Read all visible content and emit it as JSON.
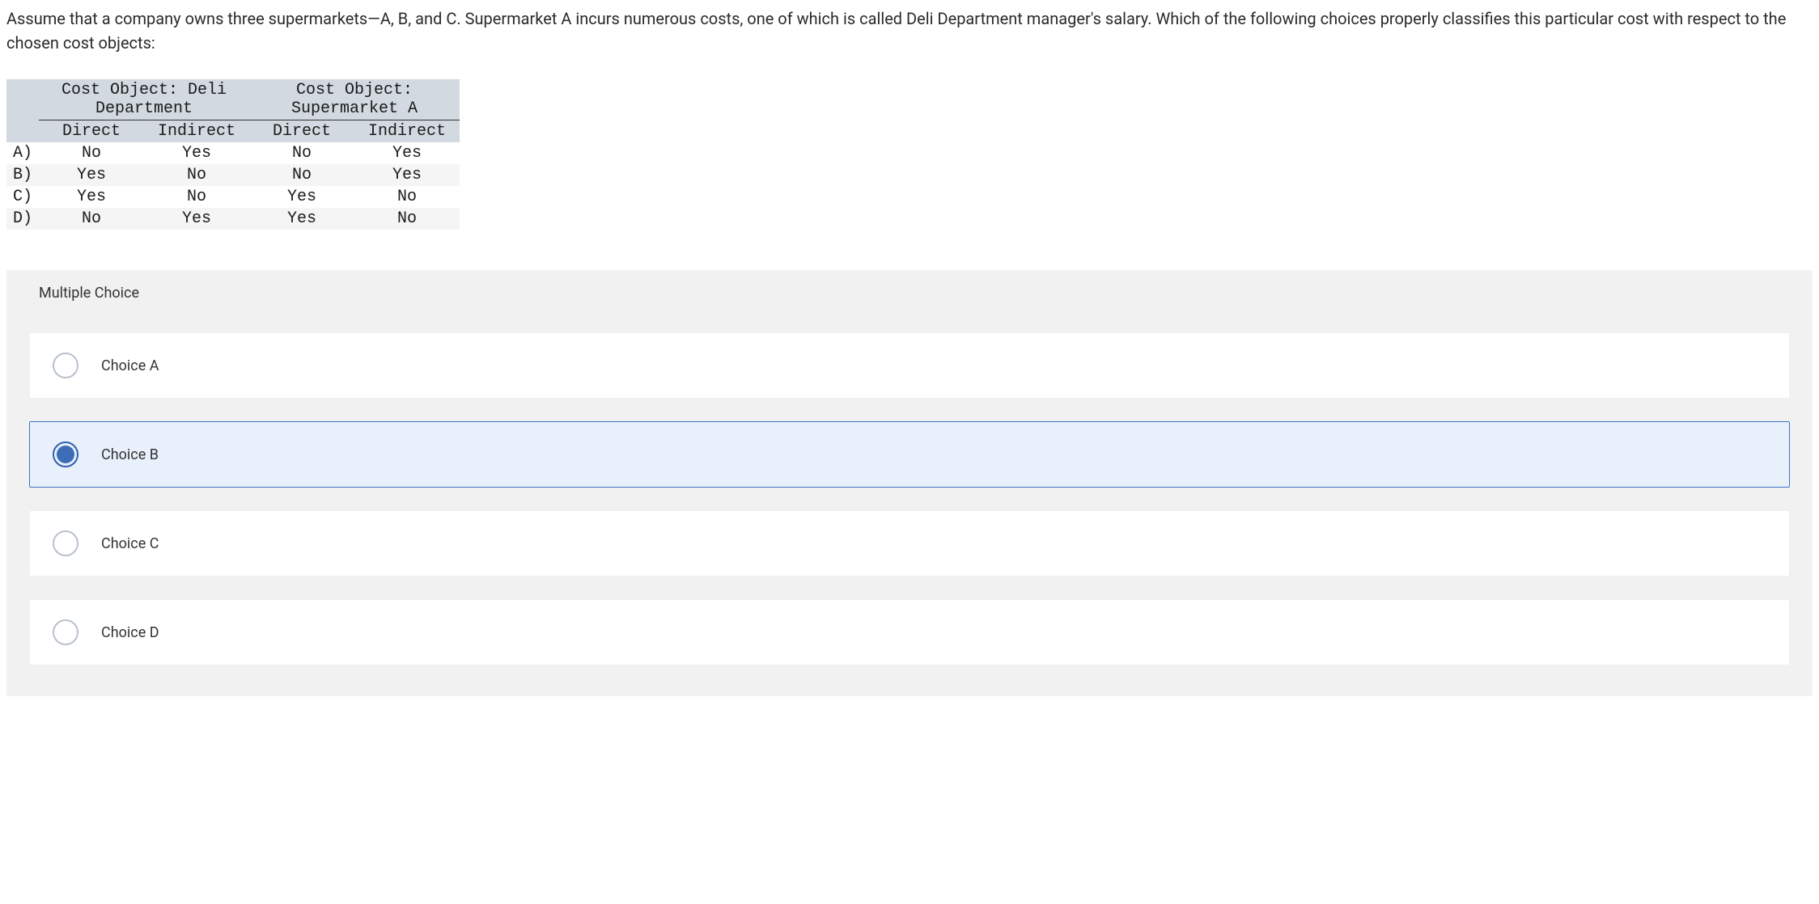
{
  "question": "Assume that a company owns three supermarkets—A, B, and C. Supermarket A incurs numerous costs, one of which is called Deli Department manager's salary. Which of the following choices properly classifies this particular cost with respect to the chosen cost objects:",
  "table": {
    "header_group1": "Cost Object: Deli Department",
    "header_group2": "Cost Object: Supermarket A",
    "sub_headers": [
      "Direct",
      "Indirect",
      "Direct",
      "Indirect"
    ],
    "rows": [
      {
        "label": "A)",
        "cells": [
          "No",
          "Yes",
          "No",
          "Yes"
        ]
      },
      {
        "label": "B)",
        "cells": [
          "Yes",
          "No",
          "No",
          "Yes"
        ]
      },
      {
        "label": "C)",
        "cells": [
          "Yes",
          "No",
          "Yes",
          "No"
        ]
      },
      {
        "label": "D)",
        "cells": [
          "No",
          "Yes",
          "Yes",
          "No"
        ]
      }
    ]
  },
  "mc_header": "Multiple Choice",
  "choices": [
    {
      "label": "Choice A",
      "selected": false
    },
    {
      "label": "Choice B",
      "selected": true
    },
    {
      "label": "Choice C",
      "selected": false
    },
    {
      "label": "Choice D",
      "selected": false
    }
  ]
}
